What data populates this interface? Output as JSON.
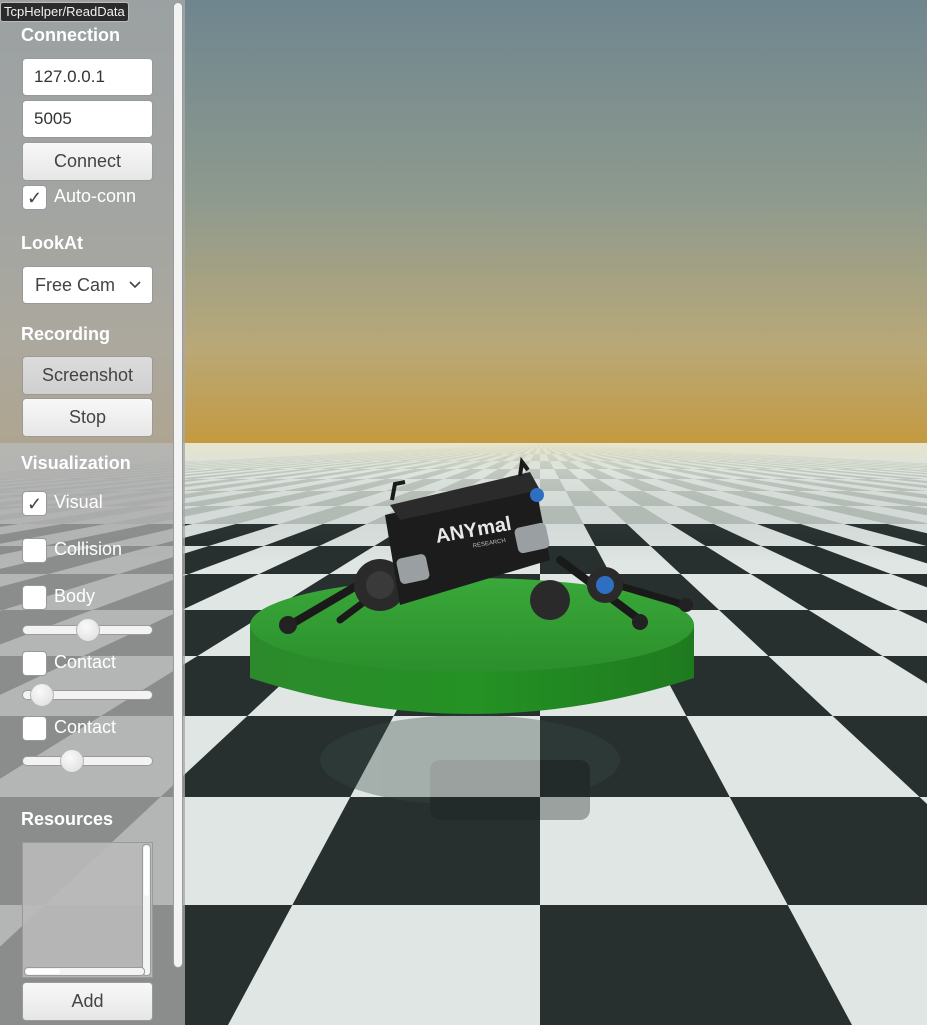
{
  "window": {
    "title": "TcpHelper/ReadData"
  },
  "connection": {
    "heading": "Connection",
    "ip_value": "127.0.0.1",
    "port_value": "5005",
    "connect_label": "Connect",
    "autoconnect_label": "Auto-conn",
    "autoconnect_checked": true
  },
  "lookat": {
    "heading": "LookAt",
    "selected": "Free Cam",
    "chevron_icon": "chevron-down-icon"
  },
  "recording": {
    "heading": "Recording",
    "screenshot_label": "Screenshot",
    "stop_label": "Stop"
  },
  "visualization": {
    "heading": "Visualization",
    "items": [
      {
        "label": "Visual",
        "checked": true
      },
      {
        "label": "Collision",
        "checked": false
      },
      {
        "label": "Body",
        "checked": false,
        "slider_value": 0.5
      },
      {
        "label": "Contact",
        "checked": false,
        "slider_value": 0.1
      },
      {
        "label": "Contact",
        "checked": false,
        "slider_value": 0.36
      }
    ]
  },
  "resources": {
    "heading": "Resources",
    "add_label": "Add"
  },
  "scene": {
    "robot_logo": "ANYmal",
    "robot_sublogo": "RESEARCH",
    "colors": {
      "platform": "#2e9a2e",
      "sky_top": "#6f8790",
      "horizon": "#c9a850"
    }
  }
}
